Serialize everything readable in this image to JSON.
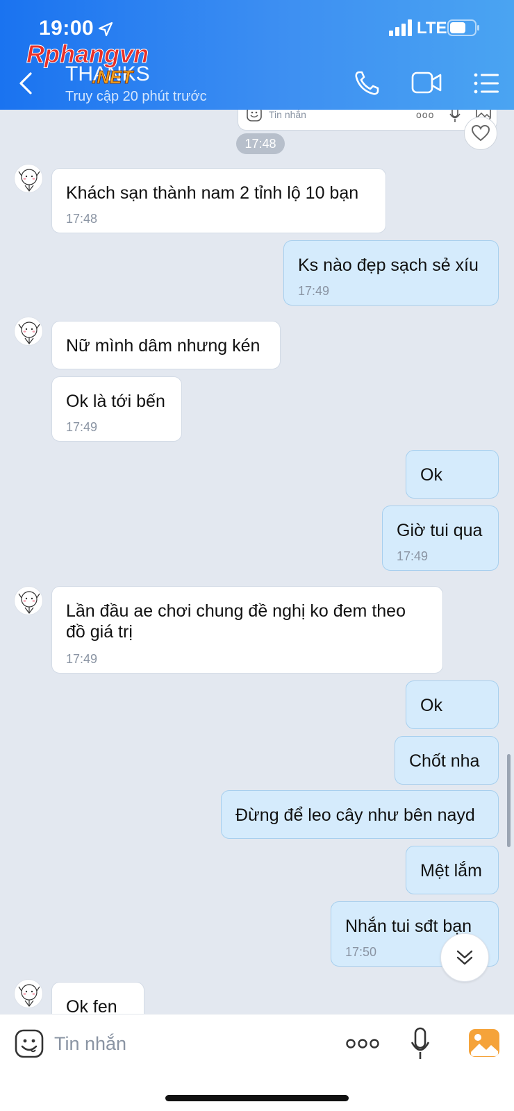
{
  "status_bar": {
    "time": "19:00",
    "network": "LTE"
  },
  "watermark": {
    "text_main": "Rphangvn",
    "text_sub": ".NET"
  },
  "header": {
    "contact_name": "THANKS",
    "contact_status": "Truy cập 20 phút trước"
  },
  "quoted_card": {
    "placeholder": "Tin nhắn",
    "more": "ooo"
  },
  "time_divider": "17:48",
  "messages": [
    {
      "dir": "in",
      "text": "Khách sạn thành nam 2 tỉnh lộ 10 bạn",
      "time": "17:48"
    },
    {
      "dir": "out",
      "text": "Ks nào đẹp sạch sẻ xíu",
      "time": "17:49"
    },
    {
      "dir": "in",
      "text": "Nữ mình dâm nhưng kén",
      "time": ""
    },
    {
      "dir": "in",
      "text": "Ok là tới bến",
      "time": "17:49"
    },
    {
      "dir": "out",
      "text": "Ok",
      "time": ""
    },
    {
      "dir": "out",
      "text": "Giờ tui qua",
      "time": "17:49"
    },
    {
      "dir": "in",
      "text": "Lần đầu ae chơi chung đề nghị ko đem theo đồ giá trị",
      "time": "17:49"
    },
    {
      "dir": "out",
      "text": "Ok",
      "time": ""
    },
    {
      "dir": "out",
      "text": "Chốt nha",
      "time": ""
    },
    {
      "dir": "out",
      "text": "Đừng để leo cây như bên nayd",
      "time": ""
    },
    {
      "dir": "out",
      "text": "Mệt lắm",
      "time": ""
    },
    {
      "dir": "out",
      "text": "Nhắn tui sđt bạn",
      "time": "17:50"
    },
    {
      "dir": "in",
      "text": "Ok fen",
      "time": ""
    }
  ],
  "input": {
    "placeholder": "Tin nhắn",
    "value": "",
    "more": "ooo"
  },
  "colors": {
    "header_start": "#1a73f0",
    "header_end": "#4aa4f2",
    "out_bubble": "#d5ebfc",
    "in_bubble": "#ffffff",
    "chat_bg": "#e3e8f0",
    "gallery_accent": "#f5a33a"
  },
  "icons": [
    "location-arrow-icon",
    "signal-icon",
    "battery-icon",
    "back-icon",
    "phone-icon",
    "video-camera-icon",
    "menu-list-icon",
    "heart-icon",
    "chevron-double-down-icon",
    "emoji-icon",
    "more-dots-icon",
    "microphone-icon",
    "gallery-icon"
  ]
}
